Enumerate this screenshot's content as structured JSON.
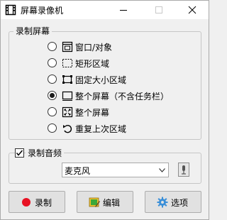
{
  "window": {
    "title": "屏幕录像机",
    "app_icon": "film-strip-icon"
  },
  "record_screen": {
    "group_label": "录制屏幕",
    "options": [
      {
        "label": "窗口/对象",
        "icon": "window-object-icon",
        "selected": false
      },
      {
        "label": "矩形区域",
        "icon": "dashed-rectangle-icon",
        "selected": false
      },
      {
        "label": "固定大小区域",
        "icon": "fixed-area-icon",
        "selected": false
      },
      {
        "label": "整个屏幕（不含任务栏）",
        "icon": "screen-no-taskbar-icon",
        "selected": true
      },
      {
        "label": "整个屏幕",
        "icon": "full-screen-icon",
        "selected": false
      },
      {
        "label": "重复上次区域",
        "icon": "repeat-area-icon",
        "selected": false
      }
    ]
  },
  "record_audio": {
    "group_label": "录制音频",
    "checked": true,
    "device": "麦克风",
    "device_button_icon": "microphone-settings-icon"
  },
  "buttons": {
    "record": "录制",
    "edit": "编辑",
    "options": "选项"
  },
  "colors": {
    "record_dot": "#e81123",
    "edit_icon_yellow": "#f2c230",
    "edit_icon_green": "#3aa83a",
    "gear_blue": "#3a8fd8"
  }
}
